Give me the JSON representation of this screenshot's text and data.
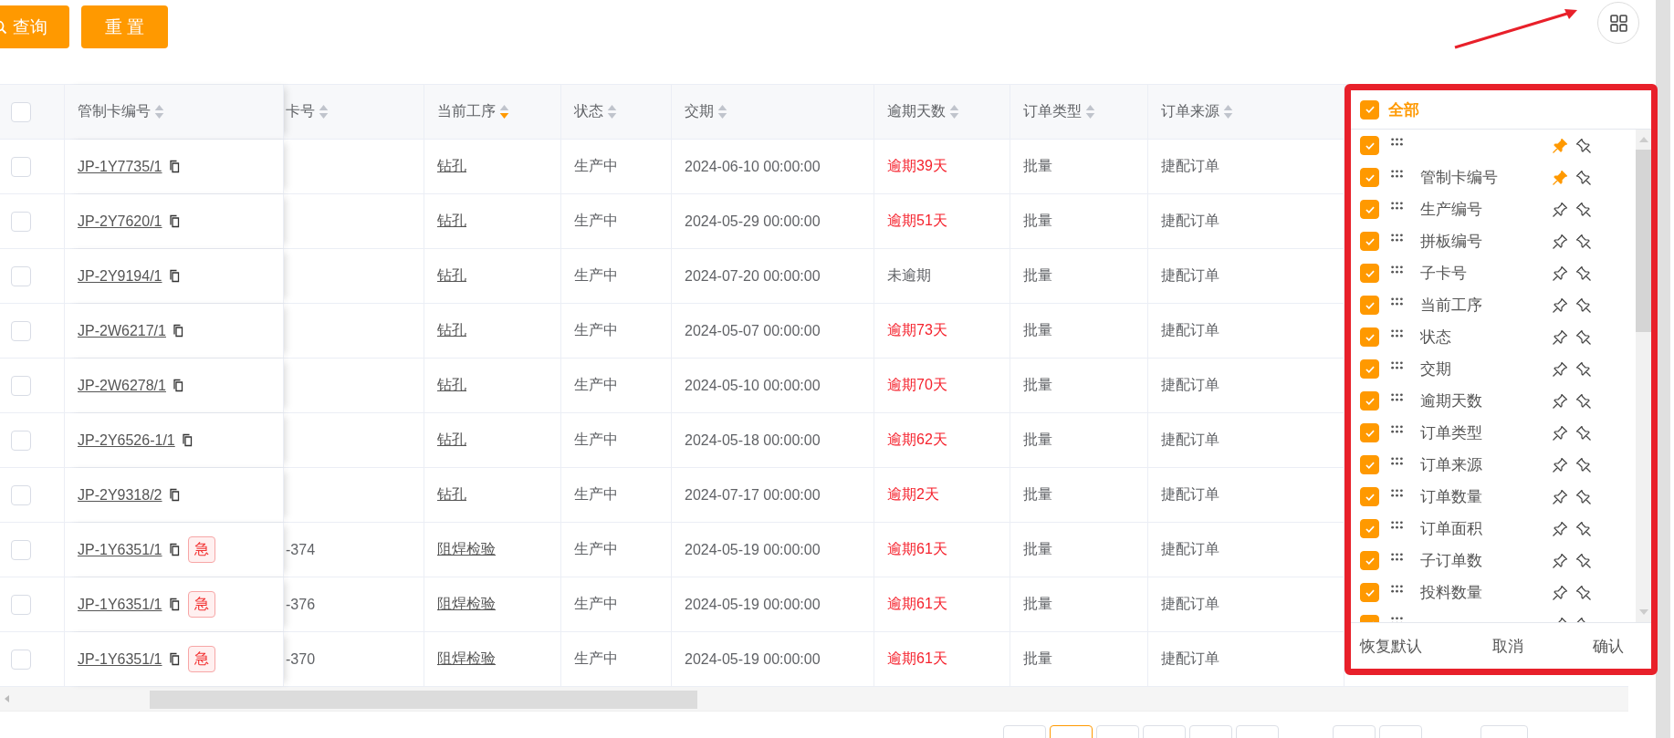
{
  "toolbar": {
    "buttons": [
      {
        "label": "查询",
        "kind": "search"
      },
      {
        "label": "重 置",
        "kind": "plain"
      }
    ]
  },
  "table": {
    "select_all": {
      "checked": false
    },
    "columns": [
      {
        "label": "管制卡编号",
        "sorted": false
      },
      {
        "label": "卡号",
        "sorted": false
      },
      {
        "label": "当前工序",
        "sorted": true
      },
      {
        "label": "状态",
        "sorted": false
      },
      {
        "label": "交期",
        "sorted": false
      },
      {
        "label": "逾期天数",
        "sorted": false
      },
      {
        "label": "订单类型",
        "sorted": false
      },
      {
        "label": "订单来源",
        "sorted": false
      }
    ],
    "rows": [
      {
        "checked": false,
        "code": "JP-1Y7735/1",
        "urgent": false,
        "process": "钻孔",
        "status": "生产中",
        "due": "2024-06-10 00:00:00",
        "overdue": "逾期39天",
        "late": true,
        "type": "批量",
        "source": "捷配订单"
      },
      {
        "checked": false,
        "code": "JP-2Y7620/1",
        "urgent": false,
        "process": "钻孔",
        "status": "生产中",
        "due": "2024-05-29 00:00:00",
        "overdue": "逾期51天",
        "late": true,
        "type": "批量",
        "source": "捷配订单"
      },
      {
        "checked": false,
        "code": "JP-2Y9194/1",
        "urgent": false,
        "process": "钻孔",
        "status": "生产中",
        "due": "2024-07-20 00:00:00",
        "overdue": "未逾期",
        "late": false,
        "type": "批量",
        "source": "捷配订单"
      },
      {
        "checked": false,
        "code": "JP-2W6217/1",
        "urgent": false,
        "process": "钻孔",
        "status": "生产中",
        "due": "2024-05-07 00:00:00",
        "overdue": "逾期73天",
        "late": true,
        "type": "批量",
        "source": "捷配订单"
      },
      {
        "checked": false,
        "code": "JP-2W6278/1",
        "urgent": false,
        "process": "钻孔",
        "status": "生产中",
        "due": "2024-05-10 00:00:00",
        "overdue": "逾期70天",
        "late": true,
        "type": "批量",
        "source": "捷配订单"
      },
      {
        "checked": false,
        "code": "JP-2Y6526-1/1",
        "urgent": false,
        "process": "钻孔",
        "status": "生产中",
        "due": "2024-05-18 00:00:00",
        "overdue": "逾期62天",
        "late": true,
        "type": "批量",
        "source": "捷配订单"
      },
      {
        "checked": false,
        "code": "JP-2Y9318/2",
        "urgent": false,
        "process": "钻孔",
        "status": "生产中",
        "due": "2024-07-17 00:00:00",
        "overdue": "逾期2天",
        "late": true,
        "type": "批量",
        "source": "捷配订单"
      },
      {
        "checked": false,
        "code": "JP-1Y6351/1",
        "urgent": true,
        "tag": "急",
        "card": "-374",
        "process": "阻焊检验",
        "status": "生产中",
        "due": "2024-05-19 00:00:00",
        "overdue": "逾期61天",
        "late": true,
        "type": "批量",
        "source": "捷配订单"
      },
      {
        "checked": false,
        "code": "JP-1Y6351/1",
        "urgent": true,
        "tag": "急",
        "card": "-376",
        "process": "阻焊检验",
        "status": "生产中",
        "due": "2024-05-19 00:00:00",
        "overdue": "逾期61天",
        "late": true,
        "type": "批量",
        "source": "捷配订单"
      },
      {
        "checked": false,
        "code": "JP-1Y6351/1",
        "urgent": true,
        "tag": "急",
        "card": "-370",
        "process": "阻焊检验",
        "status": "生产中",
        "due": "2024-05-19 00:00:00",
        "overdue": "逾期61天",
        "late": true,
        "type": "批量",
        "source": "捷配订单"
      }
    ]
  },
  "column_panel": {
    "all": {
      "label": "全部",
      "checked": true
    },
    "items": [
      {
        "checked": true,
        "pinned": true
      },
      {
        "label": "管制卡编号",
        "checked": true,
        "pinned": true
      },
      {
        "label": "生产编号",
        "checked": true,
        "pinned": false
      },
      {
        "label": "拼板编号",
        "checked": true,
        "pinned": false
      },
      {
        "label": "子卡号",
        "checked": true,
        "pinned": false
      },
      {
        "label": "当前工序",
        "checked": true,
        "pinned": false
      },
      {
        "label": "状态",
        "checked": true,
        "pinned": false
      },
      {
        "label": "交期",
        "checked": true,
        "pinned": false
      },
      {
        "label": "逾期天数",
        "checked": true,
        "pinned": false
      },
      {
        "label": "订单类型",
        "checked": true,
        "pinned": false
      },
      {
        "label": "订单来源",
        "checked": true,
        "pinned": false
      },
      {
        "label": "订单数量",
        "checked": true,
        "pinned": false
      },
      {
        "label": "订单面积",
        "checked": true,
        "pinned": false
      },
      {
        "label": "子订单数",
        "checked": true,
        "pinned": false
      },
      {
        "label": "投料数量",
        "checked": true,
        "pinned": false
      },
      {
        "checked": true,
        "pinned": false
      }
    ],
    "buttons": [
      "恢复默认",
      "取消",
      "确认"
    ]
  },
  "pagination": [
    {
      "selected": false
    },
    {
      "selected": true
    },
    {
      "selected": false
    },
    {
      "selected": false
    },
    {
      "selected": false
    },
    {
      "selected": false
    },
    {
      "selected": false
    },
    {
      "selected": false
    },
    {
      "selected": false
    }
  ]
}
